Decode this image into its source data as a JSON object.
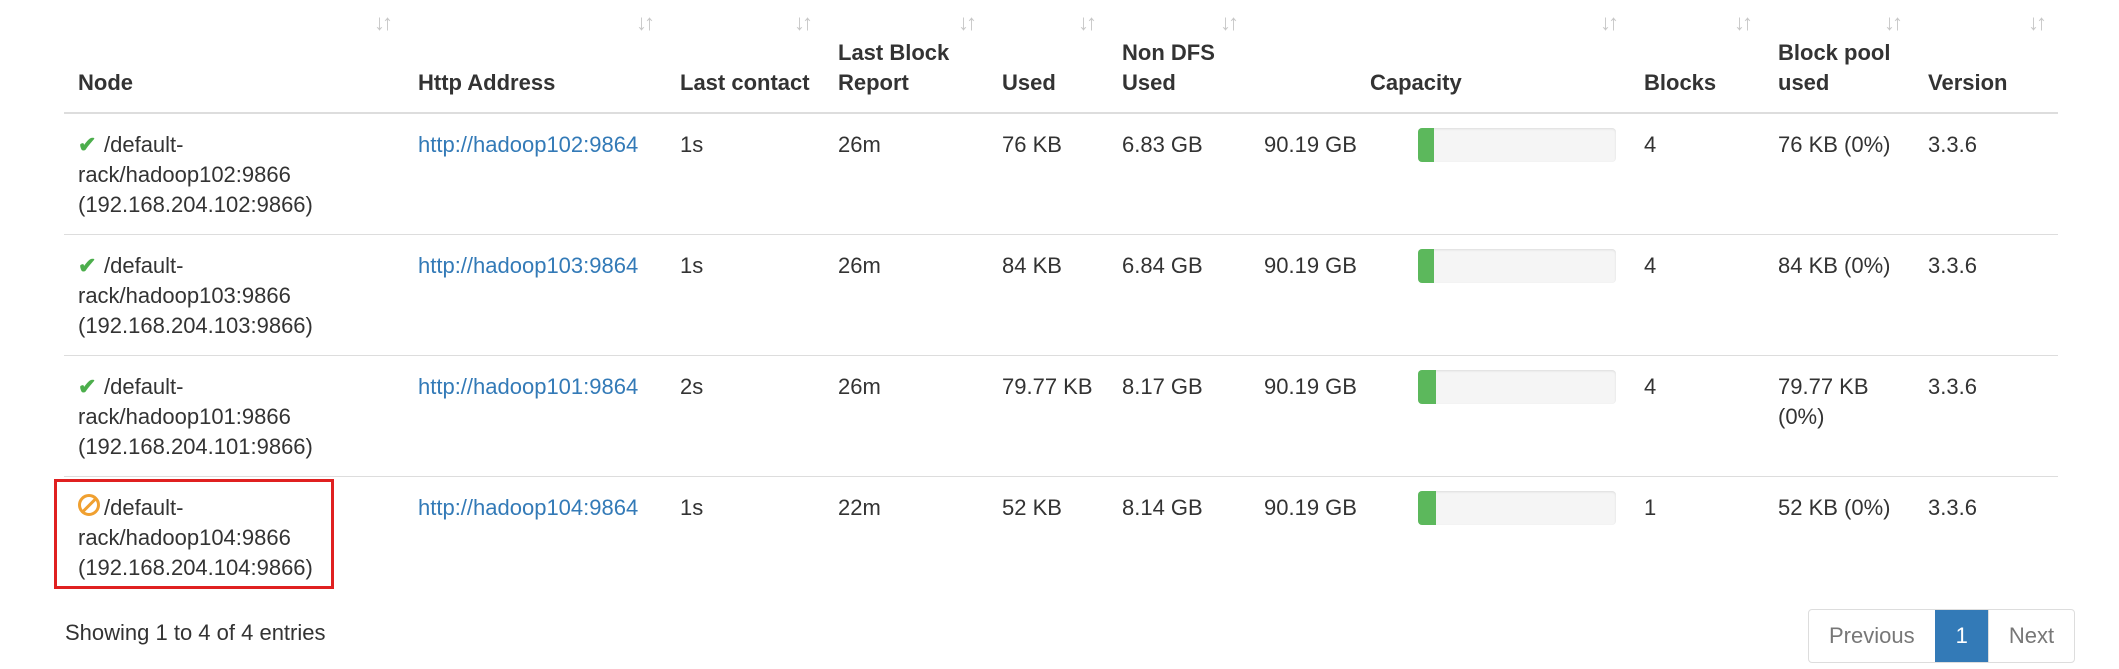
{
  "table": {
    "columns": [
      {
        "label": "Node"
      },
      {
        "label": "Http Address"
      },
      {
        "label": "Last contact"
      },
      {
        "label": "Last Block Report"
      },
      {
        "label": "Used"
      },
      {
        "label": "Non DFS Used"
      },
      {
        "label": "Capacity"
      },
      {
        "label": "Blocks"
      },
      {
        "label": "Block pool used"
      },
      {
        "label": "Version"
      }
    ],
    "sort_icon": "sort-icon",
    "rows": [
      {
        "status_icon": "check-icon",
        "node": "/default-rack/hadoop102:9866 (192.168.204.102:9866)",
        "http": "http://hadoop102:9864",
        "last_contact": "1s",
        "last_block_report": "26m",
        "used": "76 KB",
        "non_dfs_used": "6.83 GB",
        "capacity": "90.19 GB",
        "capacity_used_pct": 8,
        "blocks": "4",
        "block_pool_used": "76 KB (0%)",
        "version": "3.3.6"
      },
      {
        "status_icon": "check-icon",
        "node": "/default-rack/hadoop103:9866 (192.168.204.103:9866)",
        "http": "http://hadoop103:9864",
        "last_contact": "1s",
        "last_block_report": "26m",
        "used": "84 KB",
        "non_dfs_used": "6.84 GB",
        "capacity": "90.19 GB",
        "capacity_used_pct": 8,
        "blocks": "4",
        "block_pool_used": "84 KB (0%)",
        "version": "3.3.6"
      },
      {
        "status_icon": "check-icon",
        "node": "/default-rack/hadoop101:9866 (192.168.204.101:9866)",
        "http": "http://hadoop101:9864",
        "last_contact": "2s",
        "last_block_report": "26m",
        "used": "79.77 KB",
        "non_dfs_used": "8.17 GB",
        "capacity": "90.19 GB",
        "capacity_used_pct": 9,
        "blocks": "4",
        "block_pool_used": "79.77 KB (0%)",
        "version": "3.3.6"
      },
      {
        "status_icon": "ban-icon",
        "node": "/default-rack/hadoop104:9866 (192.168.204.104:9866)",
        "http": "http://hadoop104:9864",
        "last_contact": "1s",
        "last_block_report": "22m",
        "used": "52 KB",
        "non_dfs_used": "8.14 GB",
        "capacity": "90.19 GB",
        "capacity_used_pct": 9,
        "blocks": "1",
        "block_pool_used": "52 KB (0%)",
        "version": "3.3.6"
      }
    ]
  },
  "footer": {
    "info": "Showing 1 to 4 of 4 entries",
    "prev": "Previous",
    "page": "1",
    "next": "Next"
  },
  "colors": {
    "link": "#337ab7",
    "ok": "#4cae4c",
    "warn": "#f0a030",
    "bar_fill": "#5cb85c",
    "highlight": "#e02020"
  }
}
